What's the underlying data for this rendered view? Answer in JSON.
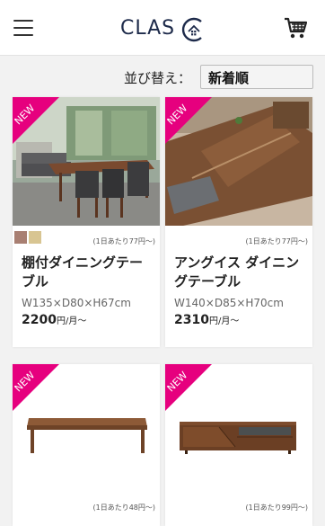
{
  "header": {
    "logo_text": "CLAS",
    "logo_c": "C"
  },
  "sort": {
    "label": "並び替え：",
    "selected": "新着順"
  },
  "badge_text": "NEW",
  "products": [
    {
      "swatches": [
        "#a87f72",
        "#d8c592"
      ],
      "per_day": "(1日あたり77円〜)",
      "name": "棚付ダイニングテーブル",
      "size": "W135×D80×H67cm",
      "price": "2200",
      "price_unit": "円/月〜"
    },
    {
      "swatches": [],
      "per_day": "(1日あたり77円〜)",
      "name": "アングイス ダイニングテーブル",
      "size": "W140×D85×H70cm",
      "price": "2310",
      "price_unit": "円/月〜"
    },
    {
      "swatches": [],
      "per_day": "(1日あたり48円〜)"
    },
    {
      "swatches": [],
      "per_day": "(1日あたり99円〜)"
    }
  ],
  "colors": {
    "badge": "#e6007e",
    "logo": "#1d2a4a"
  }
}
